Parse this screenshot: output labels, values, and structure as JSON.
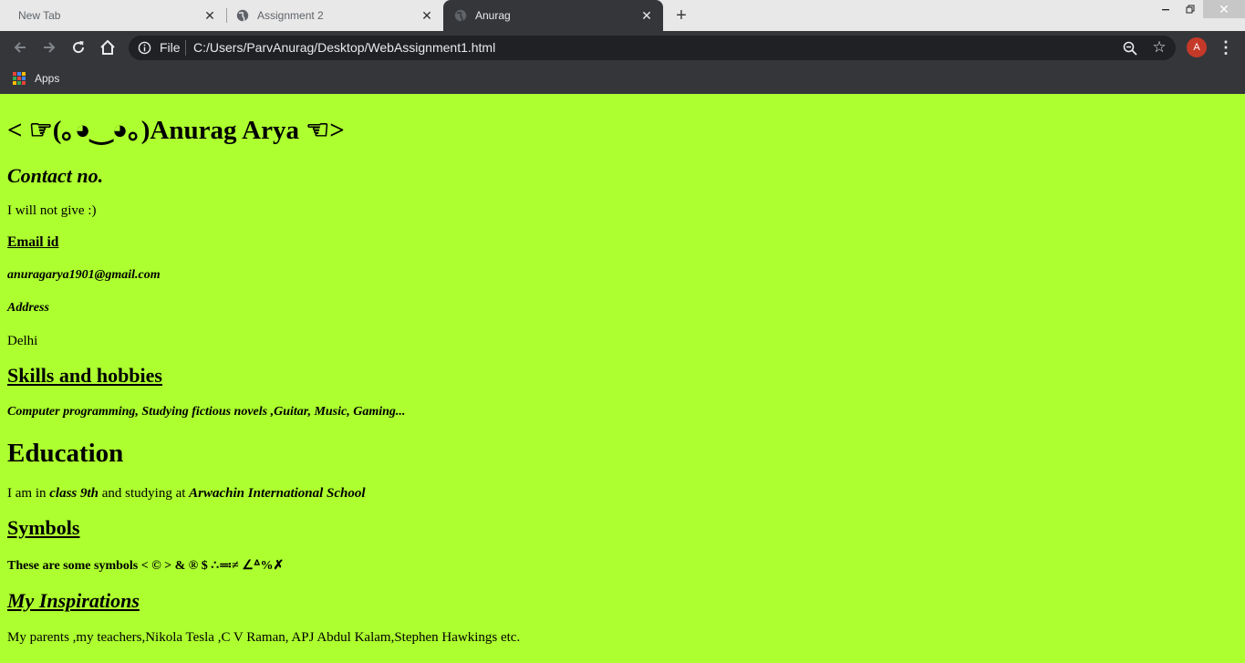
{
  "browser": {
    "tabs": [
      {
        "title": "New Tab",
        "active": false
      },
      {
        "title": "Assignment 2",
        "active": false
      },
      {
        "title": "Anurag",
        "active": true
      }
    ],
    "omnibox": {
      "scheme_label": "File",
      "url": "C:/Users/ParvAnurag/Desktop/WebAssignment1.html"
    },
    "profile_initial": "A",
    "bookmarks": {
      "apps_label": "Apps"
    },
    "colors": {
      "frame": "#e8e8e8",
      "toolbar": "#35363a",
      "omnibox": "#202124",
      "avatar": "#c53929"
    }
  },
  "page": {
    "background": "#adff2f",
    "title": "< ☞(｡◕‿◕｡)Anurag Arya ☜>",
    "contact_heading": "Contact no.",
    "contact_text": "I will not give :)",
    "email_label": "Email id",
    "email_value": "anuragarya1901@gmail.com",
    "address_label": "Address",
    "address_value": "Delhi",
    "skills_heading": "Skills and hobbies",
    "skills_value": "Computer programming, Studying fictious novels ,Guitar, Music, Gaming...",
    "education_heading": "Education",
    "education_prefix": "I am in ",
    "education_class": "class 9th",
    "education_mid": " and studying at ",
    "education_school": "Arwachin International School",
    "symbols_heading": "Symbols",
    "symbols_text": "These are some symbols < © > & ® $ ∴≕≠ ∠ᐞ%✗",
    "inspirations_heading": "My Inspirations",
    "inspirations_text": "My parents ,my teachers,Nikola Tesla ,C V Raman, APJ Abdul Kalam,Stephen Hawkings etc."
  }
}
